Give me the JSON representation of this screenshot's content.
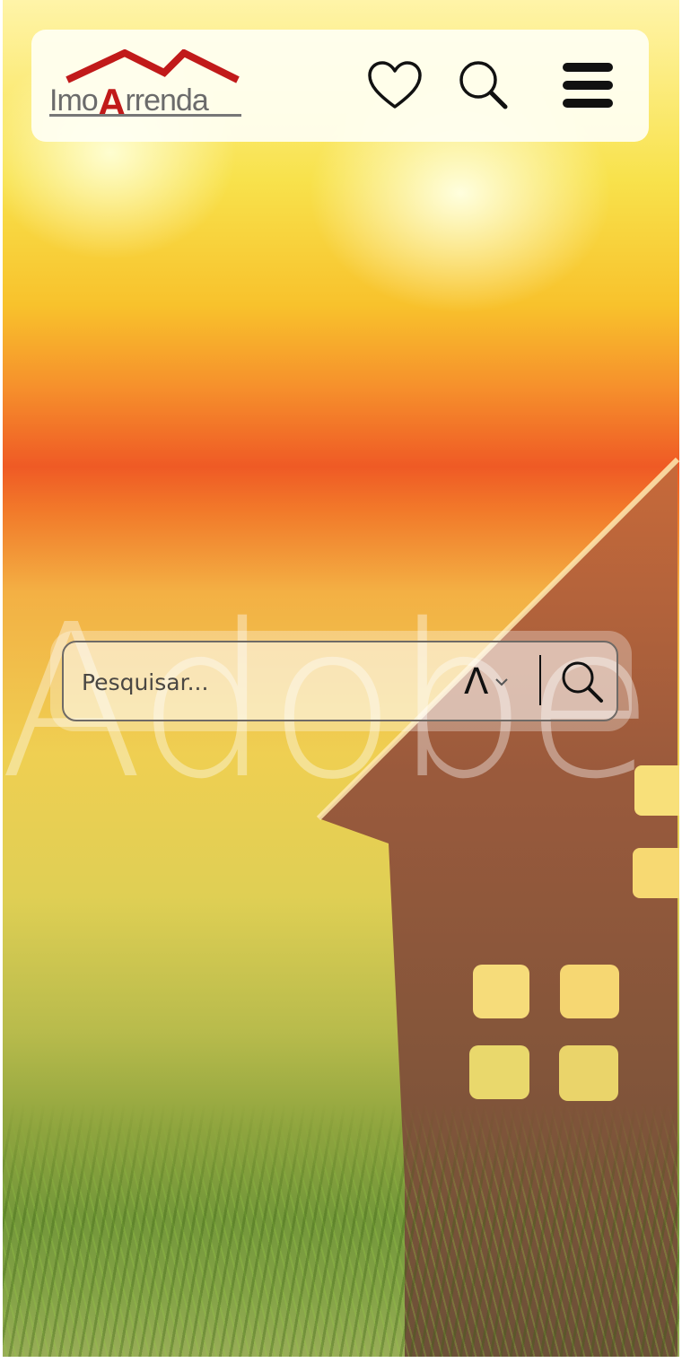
{
  "header": {
    "logo": {
      "part1": "Imo",
      "part2": "A",
      "part3": "rrenda"
    },
    "icons": {
      "favorites": "heart-icon",
      "search": "search-icon",
      "menu": "hamburger-menu-icon"
    }
  },
  "hero": {
    "watermark": "Adobe S"
  },
  "search": {
    "placeholder": "Pesquisar...",
    "type_selector": "Λ",
    "colors": {
      "border": "#6f6a66",
      "text": "#4a4743"
    }
  },
  "colors": {
    "logo_accent": "#c11a1a",
    "logo_text": "#6b6b6b",
    "header_bg": "#fffff3"
  }
}
